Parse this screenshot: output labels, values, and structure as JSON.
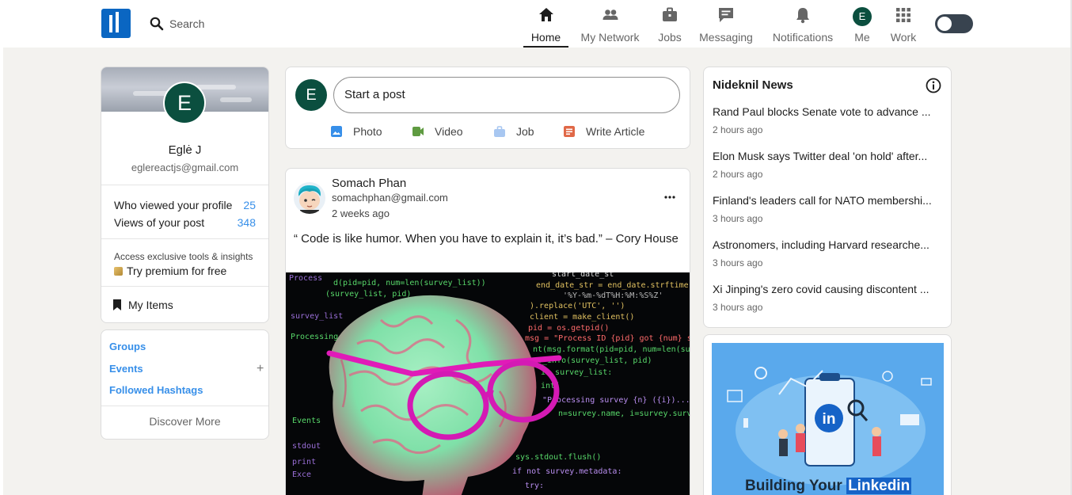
{
  "header": {
    "search_placeholder": "Search",
    "nav": [
      {
        "label": "Home",
        "icon": "home-icon",
        "active": true
      },
      {
        "label": "My Network",
        "icon": "network-icon"
      },
      {
        "label": "Jobs",
        "icon": "briefcase-icon"
      },
      {
        "label": "Messaging",
        "icon": "message-icon"
      },
      {
        "label": "Notifications",
        "icon": "bell-icon"
      },
      {
        "label": "Me",
        "icon": "avatar",
        "avatar_letter": "E"
      },
      {
        "label": "Work",
        "icon": "grid-icon"
      }
    ],
    "theme_toggle": "dark-mode-toggle"
  },
  "profile": {
    "avatar_letter": "E",
    "name": "Eglė J",
    "email": "eglereactjs@gmail.com",
    "stats": [
      {
        "label": "Who viewed your profile",
        "value": "25"
      },
      {
        "label": "Views of your post",
        "value": "348"
      }
    ],
    "premium_text": "Access exclusive tools & insights",
    "premium_link": "Try premium for free",
    "my_items": "My Items"
  },
  "groups": {
    "links": [
      "Groups",
      "Events",
      "Followed Hashtags"
    ],
    "discover": "Discover More"
  },
  "composer": {
    "avatar_letter": "E",
    "start_post": "Start a post",
    "actions": [
      {
        "label": "Photo",
        "icon": "photo-icon",
        "color": "#378fe9"
      },
      {
        "label": "Video",
        "icon": "video-icon",
        "color": "#5f9b41"
      },
      {
        "label": "Job",
        "icon": "job-icon",
        "color": "#a8c7f1"
      },
      {
        "label": "Write Article",
        "icon": "article-icon",
        "color": "#e06847"
      }
    ]
  },
  "post": {
    "author": "Somach Phan",
    "email": "somachphan@gmail.com",
    "time": "2 weeks ago",
    "text": "“ Code is like humor. When you have to explain it, it’s bad.” – Cory House",
    "code_lines": [
      "start_date_st",
      "end_date_str = end_date.strftime(",
      "'%Y-%m-%dT%H:%M:%S%Z'",
      ").replace('UTC', '')",
      "client = make_client()",
      "pid = os.getpid()",
      "msg = \"Process ID {pid} got {num} surve",
      "nt(msg.format(pid=pid, num=len(surve",
      "._info(survey_list, pid)",
      "in survey_list:",
      "int(",
      "\"Processing survey {n} ({i})...\"",
      "n=survey.name, i=survey.surv",
      "sys.stdout.flush()",
      "if not survey.metadata:",
      "try:",
      "Process",
      "d(pid=pid, num=len(survey_list))",
      "(survey_list, pid)",
      "survey_list",
      "Processing",
      "Events",
      "stdout",
      "print",
      "Exce"
    ]
  },
  "news": {
    "title": "Nideknil News",
    "items": [
      {
        "headline": "Rand Paul blocks Senate vote to advance ...",
        "time": "2 hours ago"
      },
      {
        "headline": "Elon Musk says Twitter deal 'on hold' after...",
        "time": "2 hours ago"
      },
      {
        "headline": "Finland's leaders call for NATO membershi...",
        "time": "3 hours ago"
      },
      {
        "headline": "Astronomers, including Harvard researche...",
        "time": "3 hours ago"
      },
      {
        "headline": "Xi Jinping's zero covid causing discontent ...",
        "time": "3 hours ago"
      }
    ]
  },
  "ad": {
    "text_plain": "Building Your",
    "text_highlight": "Linkedin",
    "logo_text": "in"
  }
}
